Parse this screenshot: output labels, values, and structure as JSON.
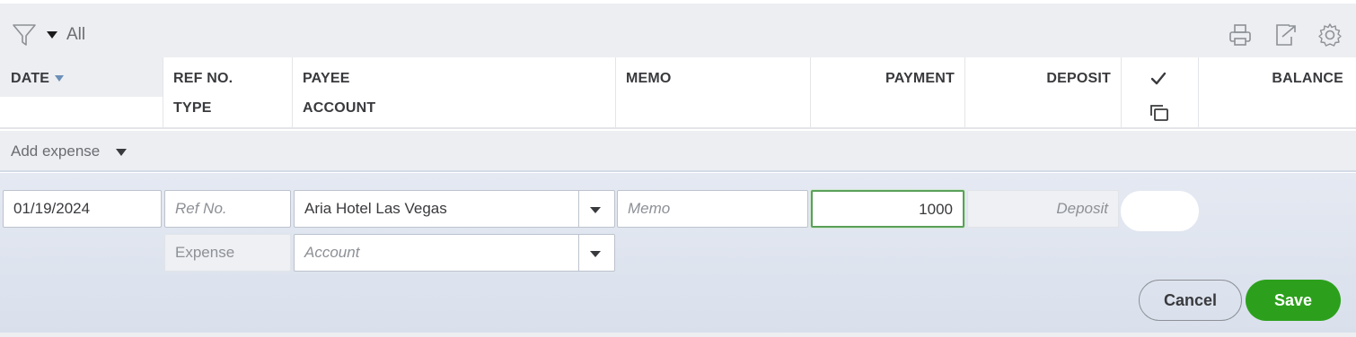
{
  "filter": {
    "value": "All"
  },
  "toolbar_icons": [
    "printer-icon",
    "export-icon",
    "gear-icon"
  ],
  "columns": {
    "date": "DATE",
    "ref_no": "REF NO.",
    "type": "TYPE",
    "payee": "PAYEE",
    "account": "ACCOUNT",
    "memo": "MEMO",
    "payment": "PAYMENT",
    "deposit": "DEPOSIT",
    "balance": "BALANCE"
  },
  "add_expense": {
    "label": "Add expense"
  },
  "edit_row": {
    "date_value": "01/19/2024",
    "ref_placeholder": "Ref No.",
    "payee_value": "Aria Hotel Las Vegas",
    "memo_placeholder": "Memo",
    "payment_value": "1000",
    "deposit_placeholder": "Deposit",
    "type_value": "Expense",
    "account_placeholder": "Account"
  },
  "buttons": {
    "cancel": "Cancel",
    "save": "Save"
  },
  "colors": {
    "accent_green": "#2ca01c",
    "focus_border": "#5aa05a",
    "header_bg": "#eceef1"
  }
}
